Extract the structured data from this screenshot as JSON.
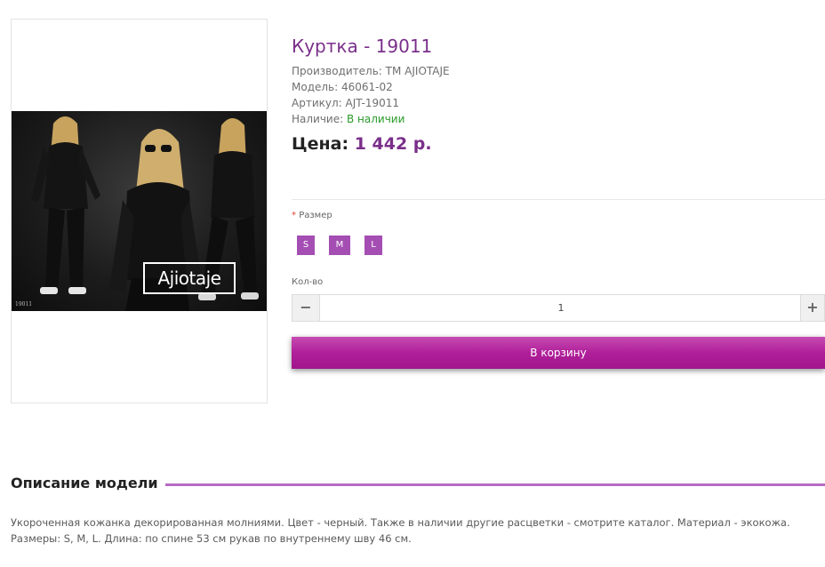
{
  "product": {
    "title": "Куртка - 19011",
    "manufacturer_label": "Производитель:",
    "manufacturer": "TM AJIOTAJE",
    "model_label": "Модель:",
    "model": "46061-02",
    "sku_label": "Артикул:",
    "sku": "AJT-19011",
    "availability_label": "Наличие:",
    "availability": "В наличии",
    "price_label": "Цена:",
    "price": "1 442 р."
  },
  "image": {
    "brand_logo": "Ajiotaje",
    "photo_code": "19011"
  },
  "options": {
    "size_required_mark": "*",
    "size_label": "Размер",
    "sizes": [
      "S",
      "M",
      "L"
    ],
    "qty_label": "Кол-во",
    "qty_value": "1",
    "qty_minus": "−",
    "qty_plus": "+"
  },
  "cart": {
    "button_label": "В корзину"
  },
  "description": {
    "heading": "Описание модели",
    "text": "Укороченная кожанка декорированная молниями. Цвет - черный. Также в наличии другие расцветки - смотрите каталог. Материал - экокожа. Размеры: S, M, L. Длина: по спине 53 см рукав по внутреннему шву 46 см."
  },
  "colors": {
    "accent": "#7a2f8a",
    "size_button": "#a44eb3",
    "cart_button": "#b01f9a",
    "in_stock": "#2a9a2a"
  }
}
